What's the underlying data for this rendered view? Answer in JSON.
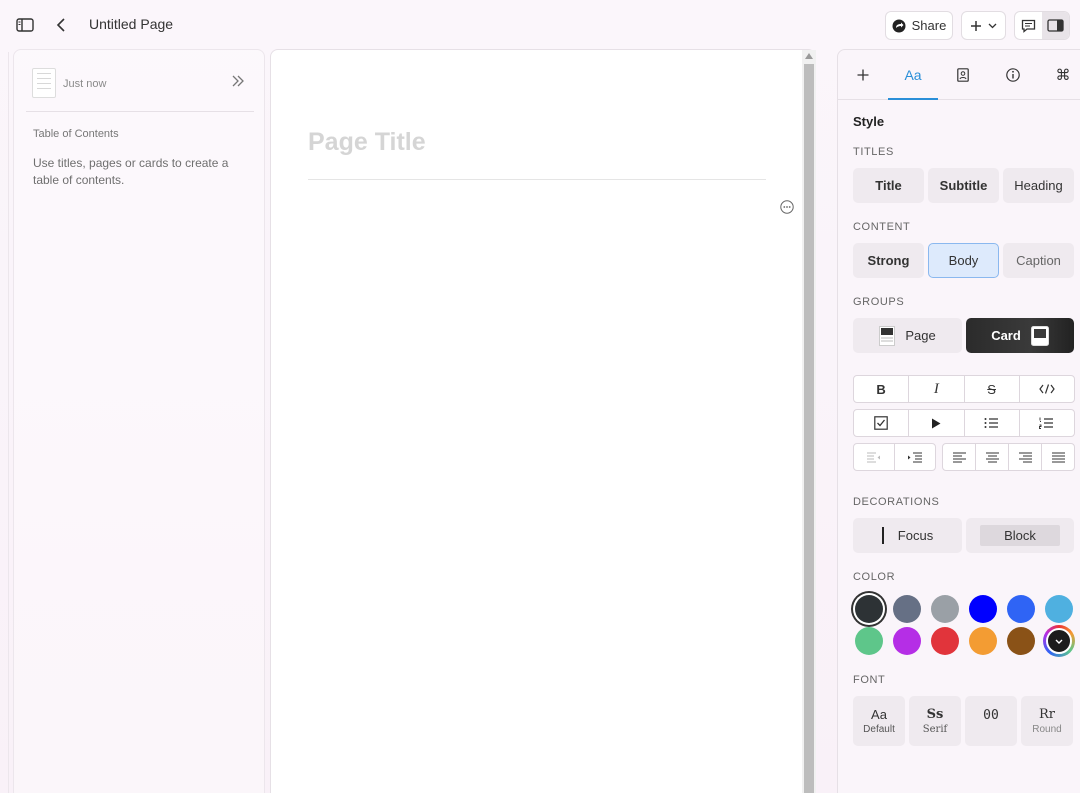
{
  "header": {
    "page_name": "Untitled Page",
    "share_label": "Share"
  },
  "sidebar": {
    "timestamp": "Just now",
    "toc_title": "Table of Contents",
    "toc_description": "Use titles, pages or cards to create a table of contents."
  },
  "editor": {
    "title_placeholder": "Page Title"
  },
  "panel": {
    "tabs": [
      "+",
      "Aa",
      "image-icon",
      "info-icon",
      "command-icon"
    ],
    "active_tab": "Aa",
    "style_heading": "Style",
    "titles_heading": "TITLES",
    "titles": [
      "Title",
      "Subtitle",
      "Heading"
    ],
    "content_heading": "CONTENT",
    "content": [
      "Strong",
      "Body",
      "Caption"
    ],
    "content_selected": "Body",
    "groups_heading": "GROUPS",
    "groups": [
      "Page",
      "Card"
    ],
    "groups_selected": "Card",
    "decorations_heading": "DECORATIONS",
    "decorations": [
      "Focus",
      "Block"
    ],
    "color_heading": "COLOR",
    "colors": [
      "#2d3235",
      "#667085",
      "#9aa0a6",
      "#0000ff",
      "#2f64f5",
      "#4fb0e0",
      "#5ec68a",
      "#b52ee6",
      "#e1343b",
      "#f39c33",
      "#8a5217",
      "#1c1c1c"
    ],
    "font_heading": "FONT",
    "fonts": [
      {
        "glyph": "Aa",
        "name": "Default"
      },
      {
        "glyph": "Ss",
        "name": "Serif"
      },
      {
        "glyph": "00",
        "name": ""
      },
      {
        "glyph": "Rr",
        "name": "Round"
      }
    ]
  }
}
